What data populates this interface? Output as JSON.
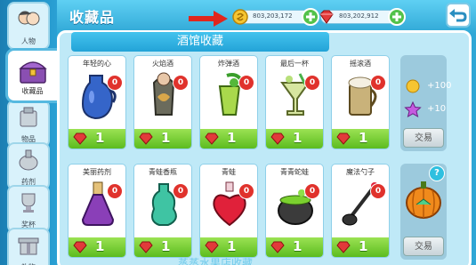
{
  "header": {
    "title": "收藏品",
    "coins": "803,203,172",
    "gems": "803,202,912"
  },
  "sidebar": {
    "items": [
      {
        "label": "人物",
        "icon": "character-icon"
      },
      {
        "label": "收藏品",
        "icon": "treasure-chest-icon"
      },
      {
        "label": "物品",
        "icon": "items-icon"
      },
      {
        "label": "药剂",
        "icon": "potion-icon"
      },
      {
        "label": "奖杯",
        "icon": "trophy-icon"
      },
      {
        "label": "礼物",
        "icon": "gift-icon"
      }
    ]
  },
  "section_title": "酒馆收藏",
  "bottom_title": "蒸蒸水果店收藏",
  "rows": [
    {
      "cards": [
        {
          "name": "年轻的心",
          "count": "0",
          "cost": "1",
          "icon": "blue-vase-icon"
        },
        {
          "name": "火焰酒",
          "count": "0",
          "cost": "1",
          "icon": "flame-bottle-icon"
        },
        {
          "name": "炸弹酒",
          "count": "0",
          "cost": "1",
          "icon": "green-bomb-cup-icon"
        },
        {
          "name": "最后一杯",
          "count": "0",
          "cost": "1",
          "icon": "cocktail-glass-icon"
        },
        {
          "name": "摇滚酒",
          "count": "0",
          "cost": "1",
          "icon": "rock-mug-icon"
        }
      ],
      "reward": {
        "coins": "+100",
        "stars": "+10",
        "button": "交易"
      }
    },
    {
      "cards": [
        {
          "name": "美丽药剂",
          "count": "0",
          "cost": "1",
          "icon": "purple-flask-icon"
        },
        {
          "name": "青蛙香瓶",
          "count": "0",
          "cost": "1",
          "icon": "green-vase-icon"
        },
        {
          "name": "青蛙",
          "count": "0",
          "cost": "1",
          "icon": "red-heart-bottle-icon"
        },
        {
          "name": "青青蛇蛙",
          "count": "0",
          "cost": "1",
          "icon": "cauldron-icon"
        },
        {
          "name": "魔法勺子",
          "count": "0",
          "cost": "1",
          "icon": "magic-spoon-icon"
        }
      ],
      "reward": {
        "help": "?",
        "icon": "pumpkin-icon",
        "button": "交易"
      }
    }
  ],
  "colors": {
    "badge": "#e0322c",
    "cost_green": "#5cbc1f",
    "accent_blue": "#2fa7d6"
  }
}
